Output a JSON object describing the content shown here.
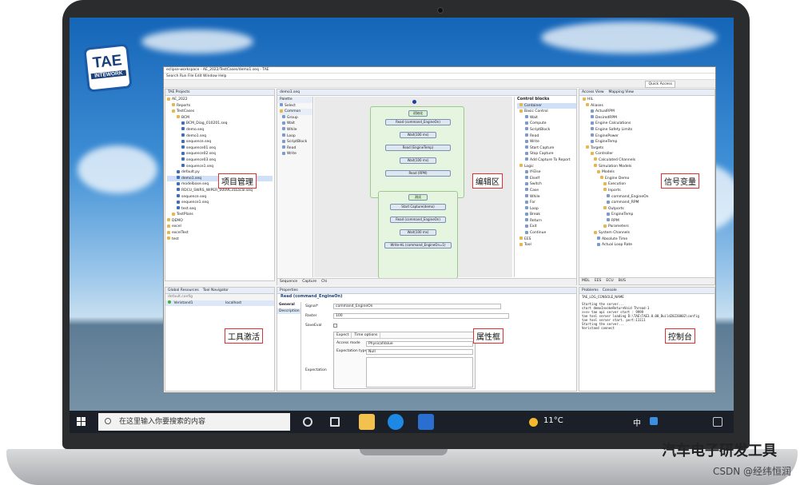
{
  "window": {
    "title": "eclipse-workspace - AE_2022/TestCases/demo1.seq - TAE",
    "menu": "Search  Run  File  Edit  Window  Help",
    "quick_access": "Quick Access"
  },
  "projects": {
    "title": "TAE Projects",
    "items": [
      "AE_2022",
      "Reports",
      "TestCases",
      "BCM",
      "BCM_Diag_010201.seq",
      "demo.seq",
      "demo1.seq",
      "sequence.seq",
      "sequence01.seq",
      "sequence02.seq",
      "sequence03.seq",
      "sequence1.seq",
      "default.py",
      "demo1.seq",
      "modelbase.seq",
      "RDCU_SWRS_WIPER_0009C31Local.seq",
      "sequence.seq",
      "sequence1.seq",
      "test.seq",
      "TestPlans",
      "DEMO",
      "excel",
      "excelTest",
      "test"
    ]
  },
  "editor": {
    "tab": "demo1.seq",
    "palette": "Palette",
    "tools": [
      "Select",
      "Common",
      "Group",
      "Wait",
      "While",
      "Loop",
      "ScriptBlock",
      "Read",
      "Write"
    ],
    "bottom_tabs": [
      "Sequence",
      "Capture",
      "Chi"
    ],
    "group1": "初始化",
    "group2": "测试",
    "blocks1": [
      "Read (command_EngineOn)",
      "Wait(100 ms)",
      "Read (EngineTemp)",
      "Wait(100 ms)",
      "Read (RPM)"
    ],
    "blocks2": [
      "Start Capture(demo)",
      "Read (command_EngineOn)",
      "Wait(100 ms)",
      "Write-HL (command_EngineOn=1)"
    ]
  },
  "control_blocks": {
    "title": "Control blocks",
    "items": [
      "Container",
      "Basic Control",
      "Wait",
      "Compute",
      "ScriptBlock",
      "Read",
      "Write",
      "Start Capture",
      "Stop Capture",
      "Add Capture To Report",
      "Logic",
      "If-Else",
      "ElseIf",
      "Switch",
      "Case",
      "While",
      "For",
      "Loop",
      "Break",
      "Return",
      "Exit",
      "Continue",
      "EES",
      "Tool"
    ]
  },
  "access": {
    "tabs": [
      "Access View",
      "Mapping View"
    ],
    "items": [
      "HIL",
      "Aliases",
      "ActualRPM",
      "DesiredRPM",
      "Engine Calculations",
      "Engine Safety Limits",
      "EnginePower",
      "EngineTemp",
      "Targets",
      "Controller",
      "Calculated Channels",
      "Simulation Models",
      "Models",
      "Engine Demo",
      "Execution",
      "Inports",
      "command_EngineOn",
      "command_RPM",
      "Outports",
      "EngineTemp",
      "RPM",
      "Parameters",
      "System Channels",
      "Absolute Time",
      "Actual Loop Rate"
    ],
    "bottom_tabs": [
      "MDL",
      "EES",
      "ECU",
      "BUS"
    ]
  },
  "global": {
    "tabs": [
      "Global Resources",
      "Tool Navigator"
    ],
    "config": "default.config",
    "tool": "Veristand1",
    "host": "localhost"
  },
  "properties": {
    "tab": "Properties",
    "title": "Read (command_EngineOn)",
    "side": [
      "General",
      "Description"
    ],
    "signal_label": "Signal*",
    "signal": "command_EngineOn",
    "raster_label": "Raster",
    "raster": "100",
    "saveval_label": "SaveEval",
    "subtabs": [
      "Expect",
      "Time options"
    ],
    "access_label": "Access mode",
    "access": "PhysicalValue",
    "exptype_label": "Expectation type",
    "exptype": "Null",
    "expectation_label": "Expectation"
  },
  "console": {
    "tabs": [
      "Problems",
      "Console"
    ],
    "name": "TAE_LOG_CONSOLE_NAME",
    "lines": [
      "Starting the server...",
      "start demoInvokeReturnVoid Thread-1",
      ">>>> tae api server start : 9999",
      "tae tool server loading D:\\TAE\\TAE3.0.00_Build20220002\\config",
      "tae tool server start. port:11111",
      "Starting the server...",
      "Veristand connect"
    ]
  },
  "annotations": {
    "projects": "项目管理",
    "editor": "编辑区",
    "signals": "信号变量",
    "tool": "工具激活",
    "props": "属性框",
    "console": "控制台"
  },
  "taskbar": {
    "search": "在这里输入你要搜索的内容",
    "temp": "11°C",
    "lang": "中"
  },
  "watermark": {
    "main": "汽车电子研发工具",
    "sub": "CSDN @经纬恒润"
  }
}
